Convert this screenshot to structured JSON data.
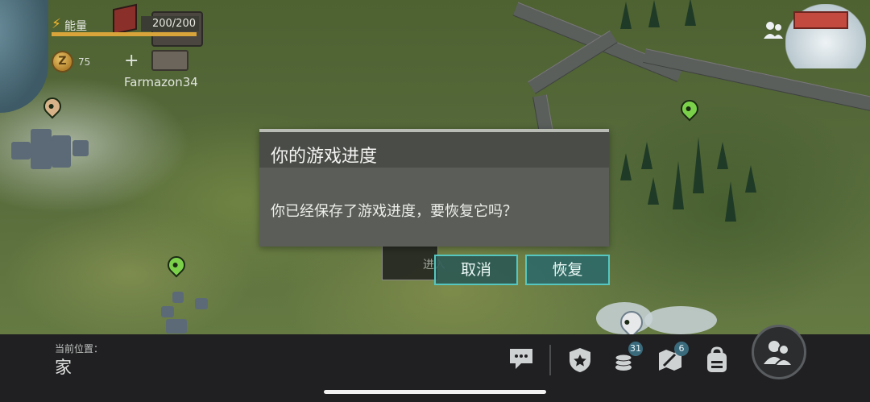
{
  "hud": {
    "energy_label": "能量",
    "energy_value": "200/200",
    "energy_current": 200,
    "energy_max": 200,
    "coin_symbol": "Z",
    "coin_count": "75",
    "add_symbol": "+",
    "player_name": "Farmazon34"
  },
  "map": {
    "enter_label": "进入"
  },
  "dialog": {
    "title": "你的游戏进度",
    "message": "你已经保存了游戏进度，要恢复它吗？",
    "cancel_label": "取消",
    "restore_label": "恢复"
  },
  "bottom_bar": {
    "location_label": "当前位置：",
    "location_value": "家",
    "tools": [
      {
        "icon": "chat-icon"
      },
      {
        "icon": "shield-star-icon"
      },
      {
        "icon": "coins-icon",
        "badge": "31"
      },
      {
        "icon": "map-icon",
        "badge": "6"
      },
      {
        "icon": "backpack-icon"
      },
      {
        "icon": "players-icon"
      }
    ]
  },
  "colors": {
    "accent_teal": "#55c7c0",
    "energy": "#d9a53a",
    "badge": "#3a6b7d"
  }
}
